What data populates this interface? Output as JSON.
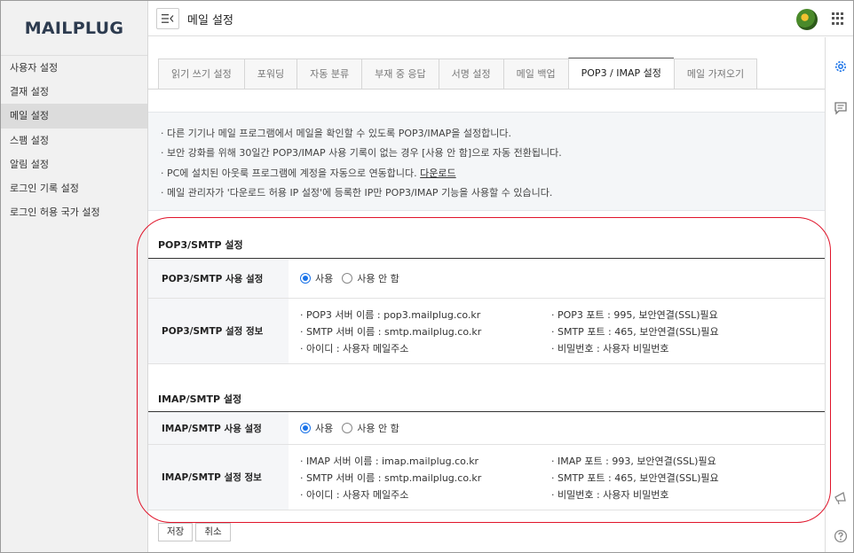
{
  "app": {
    "logo": "MAILPLUG"
  },
  "sidebar": {
    "items": [
      {
        "label": "사용자 설정"
      },
      {
        "label": "결재 설정"
      },
      {
        "label": "메일 설정",
        "active": true
      },
      {
        "label": "스팸 설정"
      },
      {
        "label": "알림 설정"
      },
      {
        "label": "로그인 기록 설정"
      },
      {
        "label": "로그인 허용 국가 설정"
      }
    ]
  },
  "header": {
    "title": "메일 설정",
    "collapse_icon": "collapse-menu-icon",
    "apps_icon": "grid-apps-icon"
  },
  "rail": {
    "icons": [
      "gear-icon",
      "message-icon",
      "megaphone-icon",
      "help-icon"
    ]
  },
  "tabs": [
    {
      "label": "읽기 쓰기 설정"
    },
    {
      "label": "포워딩"
    },
    {
      "label": "자동 분류"
    },
    {
      "label": "부재 중 응답"
    },
    {
      "label": "서명 설정"
    },
    {
      "label": "메일 백업"
    },
    {
      "label": "POP3 / IMAP 설정",
      "active": true
    },
    {
      "label": "메일 가져오기"
    }
  ],
  "notice": {
    "line1": "· 다른 기기나 메일 프로그램에서 메일을 확인할 수 있도록 POP3/IMAP을 설정합니다.",
    "line2": "· 보안 강화를 위해 30일간 POP3/IMAP 사용 기록이 없는 경우 [사용 안 함]으로 자동 전환됩니다.",
    "line3": "· PC에 설치된 아웃룩 프로그램에 계정을 자동으로 연동합니다. ",
    "line3_link": "다운로드",
    "line4": "· 메일 관리자가 '다운로드 허용 IP 설정'에 등록한 IP만 POP3/IMAP 기능을 사용할 수 있습니다."
  },
  "pop3": {
    "section_title": "POP3/SMTP 설정",
    "use_label": "POP3/SMTP 사용 설정",
    "info_label": "POP3/SMTP 설정 정보",
    "opt_on": "사용",
    "opt_off": "사용 안 함",
    "selected": "사용",
    "server": "· POP3 서버 이름 : pop3.mailplug.co.kr",
    "port": "· POP3 포트 : 995, 보안연결(SSL)필요",
    "smtp_server": "· SMTP 서버 이름 : smtp.mailplug.co.kr",
    "smtp_port": "· SMTP 포트 : 465, 보안연결(SSL)필요",
    "id": "· 아이디 : 사용자 메일주소",
    "pw": "· 비밀번호 : 사용자 비밀번호"
  },
  "imap": {
    "section_title": "IMAP/SMTP 설정",
    "use_label": "IMAP/SMTP 사용 설정",
    "info_label": "IMAP/SMTP 설정 정보",
    "opt_on": "사용",
    "opt_off": "사용 안 함",
    "selected": "사용",
    "server": "· IMAP 서버 이름 : imap.mailplug.co.kr",
    "port": "· IMAP 포트 : 993, 보안연결(SSL)필요",
    "smtp_server": "· SMTP 서버 이름 : smtp.mailplug.co.kr",
    "smtp_port": "· SMTP 포트 : 465, 보안연결(SSL)필요",
    "id": "· 아이디 : 사용자 메일주소",
    "pw": "· 비밀번호 : 사용자 비밀번호"
  },
  "buttons": {
    "save": "저장",
    "cancel": "취소"
  },
  "colors": {
    "accent": "#1a73e8",
    "highlight": "#e0142a",
    "logo": "#2d3b4f"
  }
}
